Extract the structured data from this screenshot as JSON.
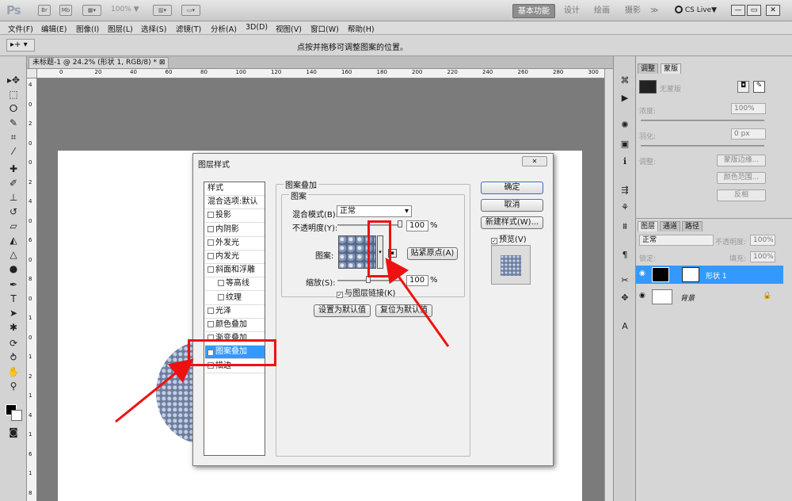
{
  "titlebar": {
    "logo": "Ps",
    "zoom": "100% ▼",
    "workspaces": [
      "基本功能",
      "设计",
      "绘画",
      "摄影",
      "≫"
    ],
    "cslive": "CS Live▼",
    "window_buttons": [
      "—",
      "▭",
      "✕"
    ]
  },
  "menubar": {
    "items": [
      "文件(F)",
      "编辑(E)",
      "图像(I)",
      "图层(L)",
      "选择(S)",
      "滤镜(T)",
      "分析(A)",
      "3D(D)",
      "视图(V)",
      "窗口(W)",
      "帮助(H)"
    ]
  },
  "options": {
    "tool": "▸+ ▾",
    "hint": "点按并拖移可调整图案的位置。"
  },
  "document": {
    "tab_title": "未标题-1 @ 24.2% (形状 1, RGB/8) *",
    "tab_close": "⊠",
    "ruler_h": [
      "0",
      "20",
      "40",
      "60",
      "80",
      "100",
      "120",
      "140",
      "160",
      "180",
      "200",
      "220",
      "240",
      "260",
      "280",
      "300"
    ],
    "ruler_v": [
      "4",
      "0",
      "2",
      "0",
      "0",
      "2",
      "4",
      "0",
      "6",
      "0",
      "8",
      "0",
      "1",
      "0",
      "1",
      "2",
      "1",
      "4",
      "1",
      "6",
      "1",
      "8"
    ]
  },
  "masks_panel": {
    "tabs": [
      "调整",
      "蒙版"
    ],
    "no_mask": "无蒙版",
    "density_label": "浓度:",
    "density_value": "100%",
    "feather_label": "羽化:",
    "feather_value": "0 px",
    "refine_label": "调整:",
    "buttons": [
      "蒙版边缘...",
      "颜色范围...",
      "反相"
    ]
  },
  "layers_panel": {
    "tabs": [
      "图层",
      "通道",
      "路径"
    ],
    "blend_mode": "正常",
    "opacity_label": "不透明度:",
    "opacity_value": "100%",
    "lock_label": "锁定:",
    "fill_label": "填充:",
    "fill_value": "100%",
    "layers": [
      {
        "name": "形状 1",
        "selected": true
      },
      {
        "name": "背景",
        "selected": false
      }
    ]
  },
  "dialog": {
    "title": "图层样式",
    "close": "✕",
    "style_list": [
      {
        "label": "样式",
        "checkbox": false,
        "checked": false,
        "indent": false,
        "selected": false
      },
      {
        "label": "混合选项:默认",
        "checkbox": false,
        "checked": false,
        "indent": false,
        "selected": false
      },
      {
        "label": "投影",
        "checkbox": true,
        "checked": false,
        "indent": false,
        "selected": false
      },
      {
        "label": "内阴影",
        "checkbox": true,
        "checked": false,
        "indent": false,
        "selected": false
      },
      {
        "label": "外发光",
        "checkbox": true,
        "checked": false,
        "indent": false,
        "selected": false
      },
      {
        "label": "内发光",
        "checkbox": true,
        "checked": false,
        "indent": false,
        "selected": false
      },
      {
        "label": "斜面和浮雕",
        "checkbox": true,
        "checked": false,
        "indent": false,
        "selected": false
      },
      {
        "label": "等高线",
        "checkbox": true,
        "checked": false,
        "indent": true,
        "selected": false
      },
      {
        "label": "纹理",
        "checkbox": true,
        "checked": false,
        "indent": true,
        "selected": false
      },
      {
        "label": "光泽",
        "checkbox": true,
        "checked": false,
        "indent": false,
        "selected": false
      },
      {
        "label": "颜色叠加",
        "checkbox": true,
        "checked": false,
        "indent": false,
        "selected": false
      },
      {
        "label": "渐变叠加",
        "checkbox": true,
        "checked": false,
        "indent": false,
        "selected": false
      },
      {
        "label": "图案叠加",
        "checkbox": true,
        "checked": true,
        "indent": false,
        "selected": true
      },
      {
        "label": "描边",
        "checkbox": true,
        "checked": false,
        "indent": false,
        "selected": false
      }
    ],
    "section_title": "图案叠加",
    "group_title": "图案",
    "blend_label": "混合模式(B):",
    "blend_value": "正常",
    "opacity_label": "不透明度(Y):",
    "opacity_value": "100",
    "opacity_unit": "%",
    "opacity_fraction": 1.0,
    "pattern_label": "图案:",
    "snap_origin": "贴紧原点(A)",
    "scale_label": "缩放(S):",
    "scale_value": "100",
    "scale_unit": "%",
    "link_label": "与图层链接(K)",
    "set_default": "设置为默认值",
    "reset_default": "复位为默认值",
    "ok": "确定",
    "cancel": "取消",
    "new_style": "新建样式(W)...",
    "preview_label": "预览(V)"
  },
  "colors": {
    "selection": "#3399ff",
    "annotation": "#ee1111"
  }
}
